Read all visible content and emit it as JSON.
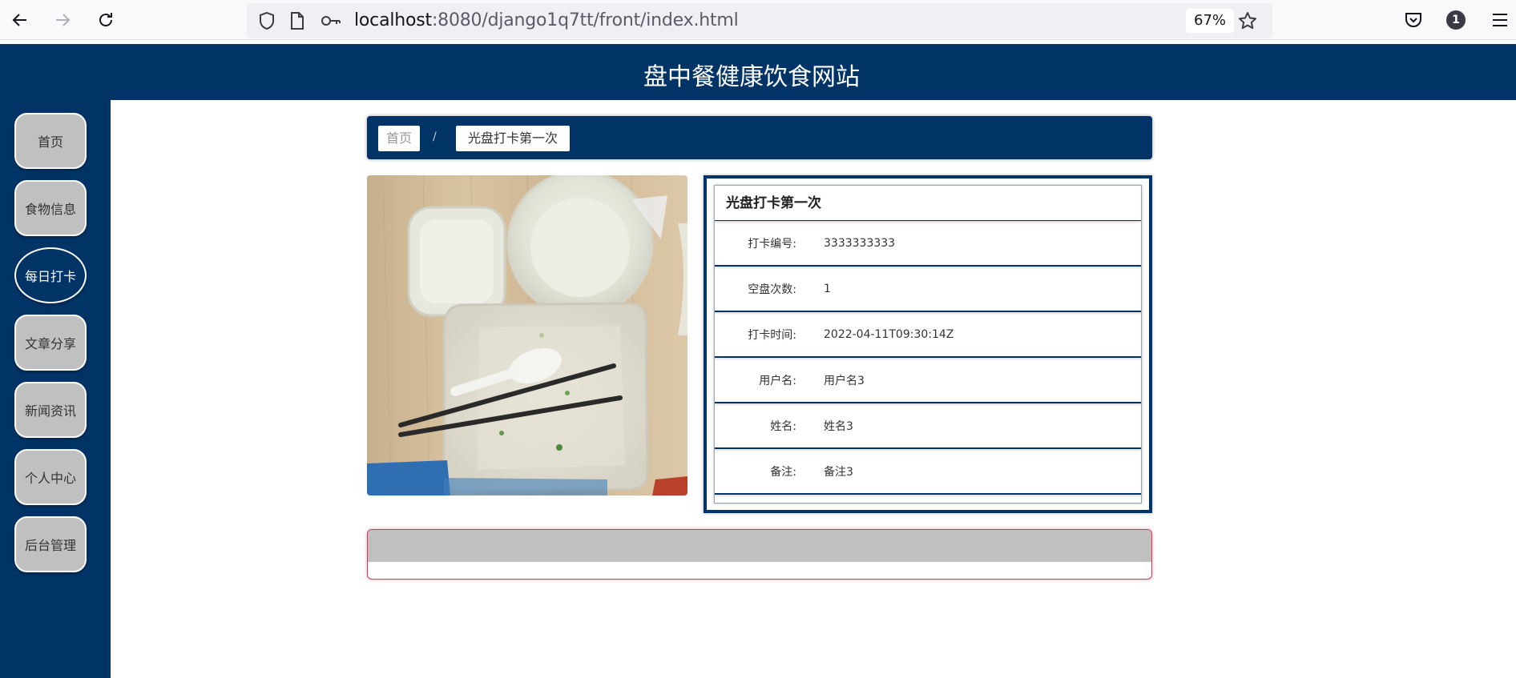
{
  "browser": {
    "url_host": "localhost",
    "url_path": ":8080/django1q7tt/front/index.html",
    "zoom": "67%",
    "notification_count": "1",
    "icons": [
      "back-icon",
      "forward-icon",
      "reload-icon",
      "shield-icon",
      "page-icon",
      "key-icon",
      "star-icon",
      "pocket-icon",
      "menu-icon"
    ]
  },
  "header": {
    "title": "盘中餐健康饮食网站"
  },
  "sidebar": {
    "items": [
      {
        "label": "首页"
      },
      {
        "label": "食物信息"
      },
      {
        "label": "每日打卡"
      },
      {
        "label": "文章分享"
      },
      {
        "label": "新闻资讯"
      },
      {
        "label": "个人中心"
      },
      {
        "label": "后台管理"
      }
    ],
    "active_index": 2
  },
  "breadcrumb": {
    "home": "首页",
    "separator": "/",
    "current": "光盘打卡第一次"
  },
  "detail": {
    "title": "光盘打卡第一次",
    "rows": [
      {
        "label": "打卡编号:",
        "value": "3333333333"
      },
      {
        "label": "空盘次数:",
        "value": "1"
      },
      {
        "label": "打卡时间:",
        "value": "2022-04-11T09:30:14Z"
      },
      {
        "label": "用户名:",
        "value": "用户名3"
      },
      {
        "label": "姓名:",
        "value": "姓名3"
      },
      {
        "label": "备注:",
        "value": "备注3"
      }
    ]
  },
  "colors": {
    "primary": "#003366",
    "sidebar_button": "#c0c0c0",
    "comment_border": "#d63a5a"
  }
}
